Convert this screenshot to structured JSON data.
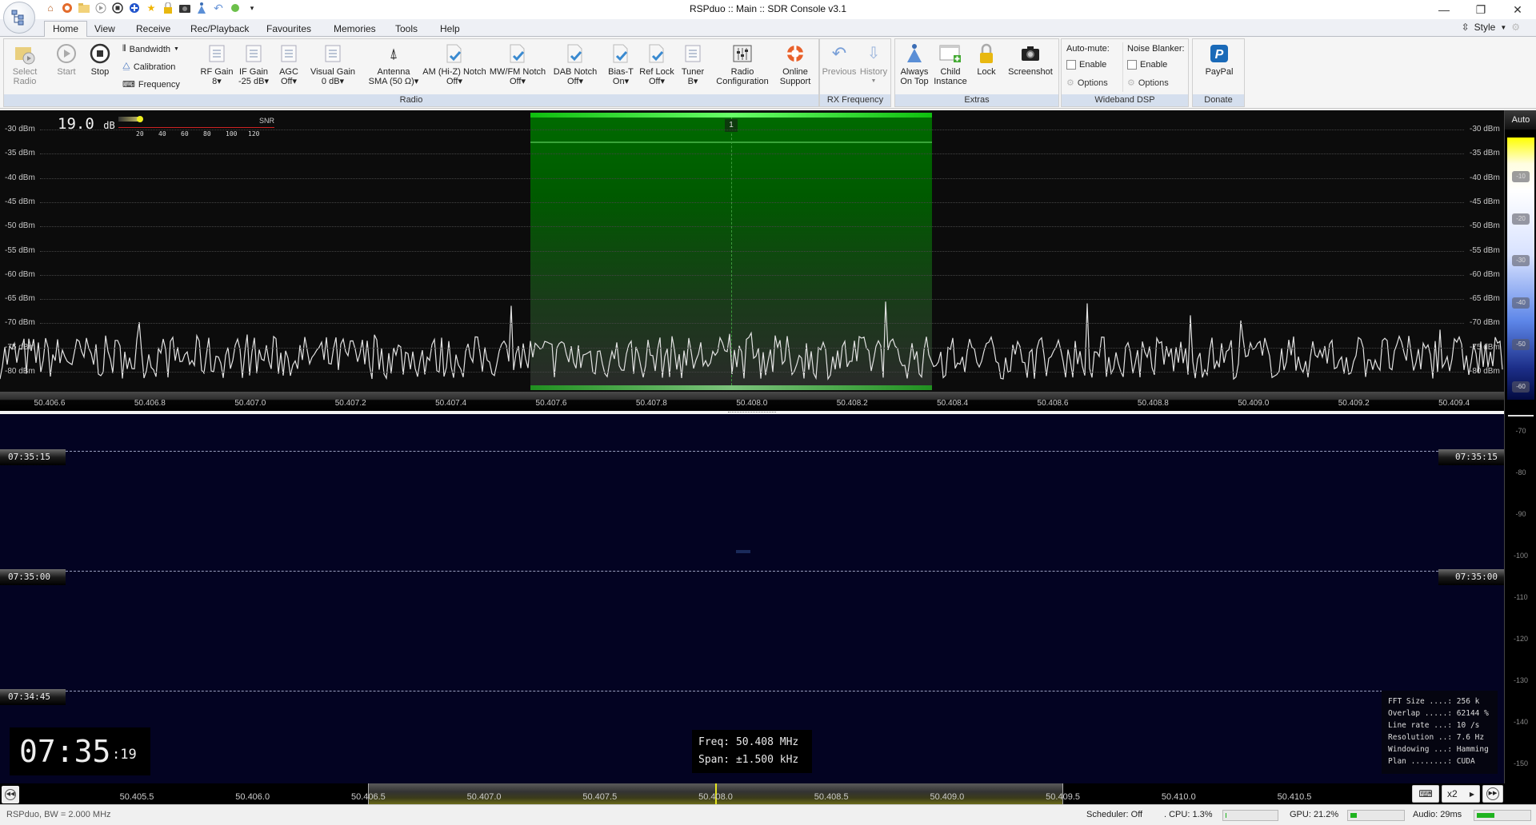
{
  "window": {
    "title": "RSPduo :: Main :: SDR Console v3.1",
    "controls": [
      "minimize",
      "maximize",
      "close"
    ]
  },
  "quick_access": [
    "home-icon",
    "lifebuoy-icon",
    "folder-icon",
    "play-icon",
    "stop-icon",
    "add-icon",
    "star-icon",
    "lock-icon",
    "camera-icon",
    "always-on-top-icon",
    "undo-icon",
    "status-dot-icon",
    "customize-icon"
  ],
  "tabs": [
    "Home",
    "View",
    "Receive",
    "Rec/Playback",
    "Favourites",
    "Memories",
    "Tools",
    "Help"
  ],
  "active_tab": "Home",
  "style_menu": "Style",
  "ribbon": {
    "select_radio": {
      "line1": "Select",
      "line2": "Radio"
    },
    "start": "Start",
    "stop": "Stop",
    "bandwidth": "Bandwidth",
    "calibration": "Calibration",
    "frequency": "Frequency",
    "rf_gain": {
      "label": "RF Gain",
      "value": "8"
    },
    "if_gain": {
      "label": "IF Gain",
      "value": "-25 dB"
    },
    "agc": {
      "label": "AGC",
      "value": "Off"
    },
    "visual_gain": {
      "label": "Visual Gain",
      "value": "0 dB"
    },
    "antenna": {
      "label": "Antenna",
      "value": "SMA (50 Ω)"
    },
    "am_notch": {
      "label": "AM (Hi-Z) Notch",
      "value": "Off"
    },
    "mwfm_notch": {
      "label": "MW/FM Notch",
      "value": "Off"
    },
    "dab_notch": {
      "label": "DAB Notch",
      "value": "Off"
    },
    "bias_t": {
      "label": "Bias-T",
      "value": "On"
    },
    "ref_lock": {
      "label": "Ref Lock",
      "value": "Off"
    },
    "tuner": {
      "label": "Tuner",
      "value": "B"
    },
    "radio_config": {
      "line1": "Radio",
      "line2": "Configuration"
    },
    "online_support": {
      "line1": "Online",
      "line2": "Support"
    },
    "radio_group": "Radio",
    "previous": "Previous",
    "history": "History",
    "rx_group": "RX Frequency",
    "always_on_top": {
      "line1": "Always",
      "line2": "On Top"
    },
    "child_instance": {
      "line1": "Child",
      "line2": "Instance"
    },
    "lock": "Lock",
    "screenshot": "Screenshot",
    "extras_group": "Extras",
    "auto_mute": "Auto-mute:",
    "noise_blanker": "Noise Blanker:",
    "enable": "Enable",
    "options": "Options",
    "wideband_group": "Wideband DSP",
    "paypal": "PayPal",
    "donate_group": "Donate"
  },
  "spectrum": {
    "snr_value": "19.0",
    "snr_unit": "dB",
    "snr_label": "SNR",
    "snr_scale": [
      "20",
      "40",
      "60",
      "80",
      "100",
      "120"
    ],
    "snr_level_db": 19.0,
    "db_labels": [
      "-30 dBm",
      "-35 dBm",
      "-40 dBm",
      "-45 dBm",
      "-50 dBm",
      "-55 dBm",
      "-60 dBm",
      "-65 dBm",
      "-70 dBm",
      "-75 dBm",
      "-80 dBm"
    ],
    "freq_labels": [
      "50.406.6",
      "50.406.8",
      "50.407.0",
      "50.407.2",
      "50.407.4",
      "50.407.6",
      "50.407.8",
      "50.408.0",
      "50.408.2",
      "50.408.4",
      "50.408.6",
      "50.408.8",
      "50.409.0",
      "50.409.2",
      "50.409.4"
    ],
    "vfo_label": "1",
    "noise_floor_dbm": -77
  },
  "colorbar": {
    "auto": "Auto",
    "ticks": [
      "-10",
      "-20",
      "-30",
      "-40",
      "-50",
      "-60"
    ],
    "waterfall_ticks": [
      "-70",
      "-80",
      "-90",
      "-100",
      "-110",
      "-120",
      "-130",
      "-140",
      "-150"
    ]
  },
  "waterfall": {
    "time_labels": [
      "07:35:15",
      "07:35:00",
      "07:34:45"
    ],
    "clock_hm": "07:35",
    "clock_s": ":19",
    "freq_readout": "Freq: 50.408 MHz",
    "span_readout": "Span: ±1.500 kHz",
    "fft_info": [
      "FFT Size ....: 256 k",
      "Overlap .....: 62144 %",
      "Line rate ...: 10 /s",
      "Resolution ..: 7.6 Hz",
      "Windowing ...: Hamming",
      "Plan ........: CUDA"
    ]
  },
  "overview_axis": {
    "labels": [
      "50.405.5",
      "50.406.0",
      "50.406.5",
      "50.407.0",
      "50.407.5",
      "50.408.0",
      "50.408.5",
      "50.409.0",
      "50.409.5",
      "50.410.0",
      "50.410.5"
    ],
    "zoom": "x2"
  },
  "status": {
    "device": "RSPduo, BW = 2.000 MHz",
    "scheduler": "Scheduler: Off",
    "cpu": ". CPU: 1.3%",
    "cpu_pct": 1.3,
    "gpu": "GPU: 21.2%",
    "gpu_pct": 21.2,
    "audio": "Audio: 29ms"
  },
  "colors": {
    "filter_green": "#00b000",
    "waterfall_bg": "#030322",
    "spectrum_bg": "#0c0c0c",
    "trace": "#e0e0e0",
    "ribbon_group": "#d5dfee"
  }
}
